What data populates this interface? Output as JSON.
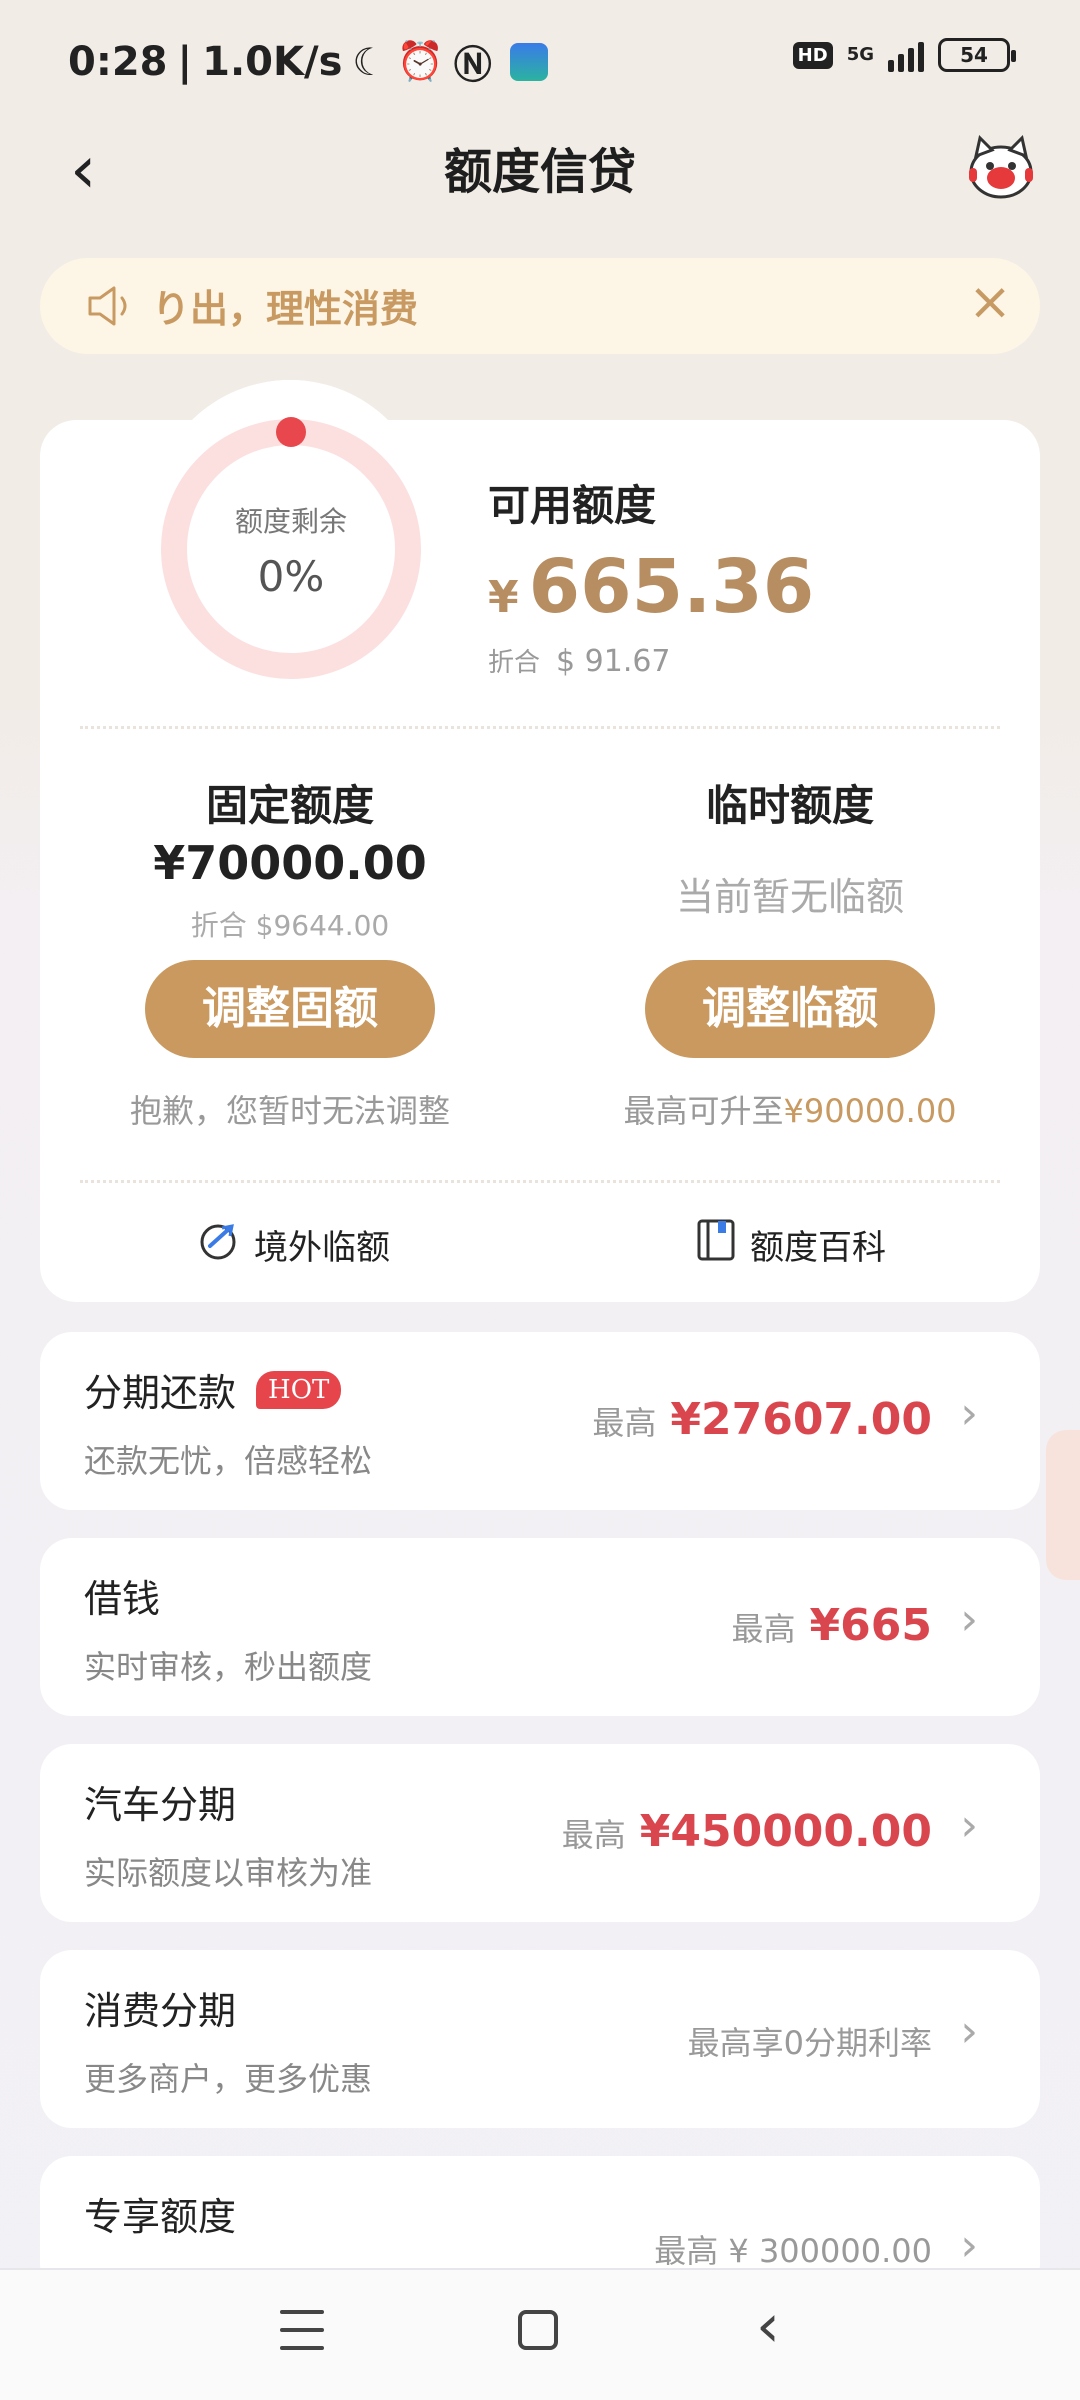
{
  "status_bar": {
    "time": "0:28",
    "speed": "1.0K/s",
    "hd": "HD",
    "network": "5G",
    "battery": "54"
  },
  "header": {
    "title": "额度信贷"
  },
  "notice": {
    "text": "り出，理性消费"
  },
  "credit": {
    "ring_label": "额度剩余",
    "ring_percent": "0%",
    "ring_fraction": 0.0,
    "available_label": "可用额度",
    "currency_symbol": "¥",
    "available_amount": "665.36",
    "usd_prefix": "折合",
    "usd_amount": "$ 91.67",
    "fixed": {
      "title": "固定额度",
      "amount": "¥70000.00",
      "usd": "折合 $9644.00",
      "button": "调整固额",
      "note": "抱歉，您暂时无法调整"
    },
    "temporary": {
      "title": "临时额度",
      "status": "当前暂无临额",
      "button": "调整临额",
      "note_prefix": "最高可升至",
      "note_value": "¥90000.00"
    },
    "tools": {
      "overseas": "境外临额",
      "wiki": "额度百科"
    }
  },
  "products": [
    {
      "title": "分期还款",
      "badge": "HOT",
      "subtitle": "还款无忧，倍感轻松",
      "prefix": "最高",
      "value": "¥27607.00"
    },
    {
      "title": "借钱",
      "subtitle": "实时审核，秒出额度",
      "prefix": "最高",
      "value": "¥665"
    },
    {
      "title": "汽车分期",
      "subtitle": "实际额度以审核为准",
      "prefix": "最高",
      "value": "¥450000.00"
    },
    {
      "title": "消费分期",
      "subtitle": "更多商户，更多优惠",
      "plain": "最高享0分期利率"
    },
    {
      "title": "专享额度",
      "plain": "最高 ¥ 300000.00"
    }
  ],
  "colors": {
    "gold": "#c9995f",
    "red": "#d9464e",
    "ring_track": "#fbe0df",
    "ring_dot": "#e8484d"
  }
}
